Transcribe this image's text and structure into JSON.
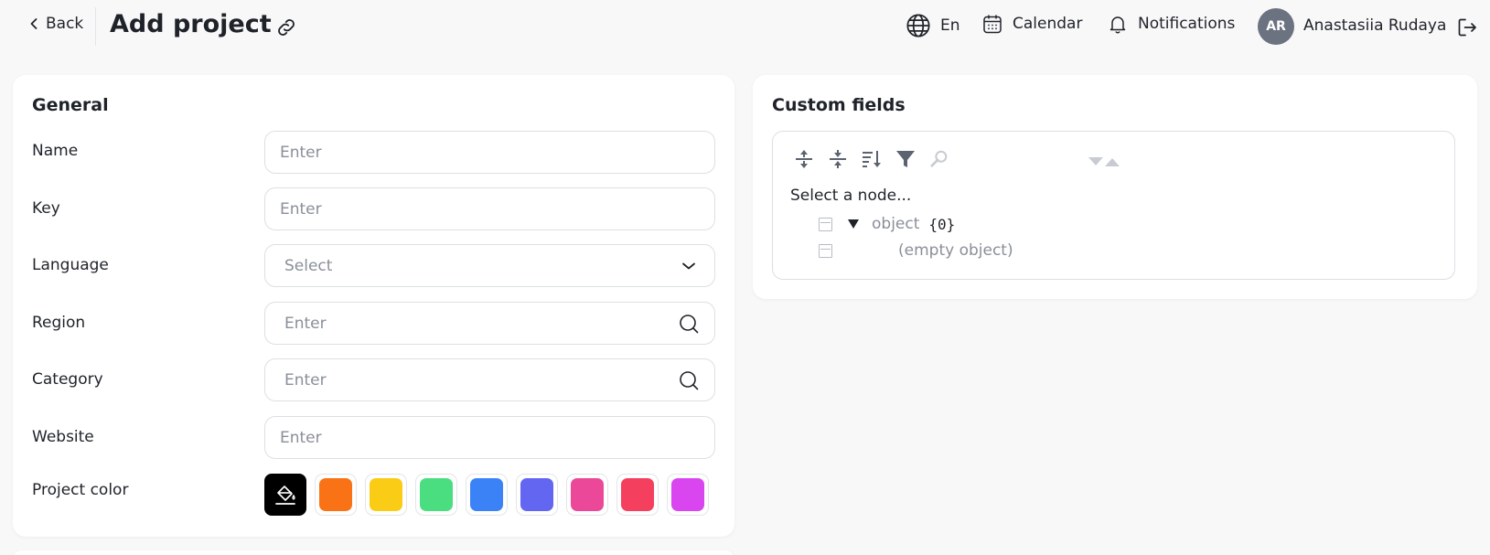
{
  "header": {
    "back_label": "Back",
    "title": "Add project",
    "language": "En",
    "calendar": "Calendar",
    "notifications": "Notifications",
    "user_initials": "AR",
    "user_name": "Anastasiia Rudaya"
  },
  "general": {
    "title": "General",
    "fields": {
      "name": {
        "label": "Name",
        "placeholder": "Enter"
      },
      "key": {
        "label": "Key",
        "placeholder": "Enter"
      },
      "language": {
        "label": "Language",
        "placeholder": "Select"
      },
      "region": {
        "label": "Region",
        "placeholder": "Enter"
      },
      "category": {
        "label": "Category",
        "placeholder": "Enter"
      },
      "website": {
        "label": "Website",
        "placeholder": "Enter"
      }
    },
    "project_color": {
      "label": "Project color",
      "colors": [
        "#000000",
        "#f97316",
        "#facc15",
        "#4ade80",
        "#3b82f6",
        "#6366f1",
        "#ec4899",
        "#f43f5e",
        "#d946ef"
      ]
    }
  },
  "custom_fields": {
    "title": "Custom fields",
    "node_hint": "Select a node...",
    "root_key": "object",
    "root_count": "{0}",
    "empty_text": "(empty object)"
  },
  "colors": {
    "accent_dark": "#1f2329",
    "muted": "#8a8f98",
    "border": "#dcdfe3",
    "avatar_bg": "#6b7280"
  }
}
